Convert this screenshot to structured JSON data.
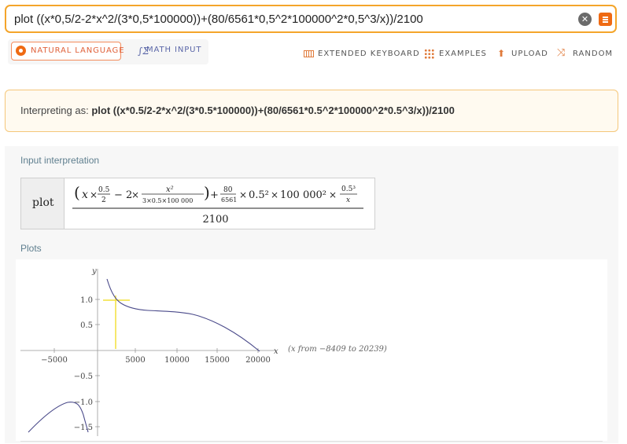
{
  "search": {
    "query": "plot ((x*0,5/2-2*x^2/(3*0,5*100000))+(80/6561*0,5^2*100000^2*0,5^3/x))/2100",
    "clear_icon": "clear-icon",
    "submit_icon": "submit-icon"
  },
  "modes": {
    "natural_language": "NATURAL LANGUAGE",
    "math_input": "MATH INPUT"
  },
  "tools": {
    "extended_keyboard": "EXTENDED KEYBOARD",
    "examples": "EXAMPLES",
    "upload": "UPLOAD",
    "random": "RANDOM"
  },
  "interpreting": {
    "prefix": "Interpreting as:",
    "expression": "plot ((x*0.5/2-2*x^2/(3*0.5*100000))+(80/6561*0.5^2*100000^2*0.5^3/x))/2100"
  },
  "input_interpretation": {
    "title": "Input interpretation",
    "plot_label": "plot",
    "denominator": "2100"
  },
  "plots": {
    "title": "Plots",
    "range_note": "(x from −8409 to 20239)",
    "x_axis_label": "x",
    "y_axis_label": "y",
    "x_ticks": [
      "−5000",
      "5000",
      "10000",
      "15000",
      "20000"
    ],
    "y_ticks": [
      "1.0",
      "0.5",
      "−0.5",
      "−1.0",
      "−1.5"
    ]
  },
  "colors": {
    "accent": "#f4a52a",
    "brand_orange": "#ef6a13",
    "curve": "#4a4a8a",
    "highlight": "#f2e03a"
  }
}
